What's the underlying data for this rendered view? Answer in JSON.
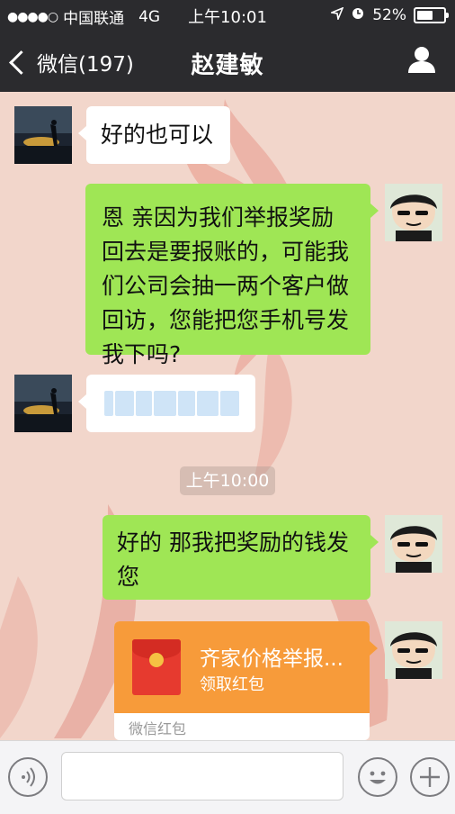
{
  "status_bar": {
    "carrier": "中国联通",
    "network": "4G",
    "time": "上午10:01",
    "battery": "52%"
  },
  "nav": {
    "back_label": "微信(197)",
    "title": "赵建敏"
  },
  "messages": [
    {
      "side": "left",
      "text": "好的也可以"
    },
    {
      "side": "right",
      "text": "恩  亲因为我们举报奖励回去是要报账的，可能我们公司会抽一两个客户做回访，您能把您手机号发我下吗?"
    },
    {
      "side": "left",
      "text": ""
    },
    {
      "side": "right",
      "text": "好的 那我把奖励的钱发您"
    }
  ],
  "timestamp": "上午10:00",
  "red_packet": {
    "title": "齐家价格举报...",
    "subtitle": "领取红包",
    "footer": "微信红包"
  },
  "colors": {
    "nav_bg": "#2b2b2e",
    "green_bubble": "#9fe655",
    "red_packet": "#f79b3a"
  }
}
